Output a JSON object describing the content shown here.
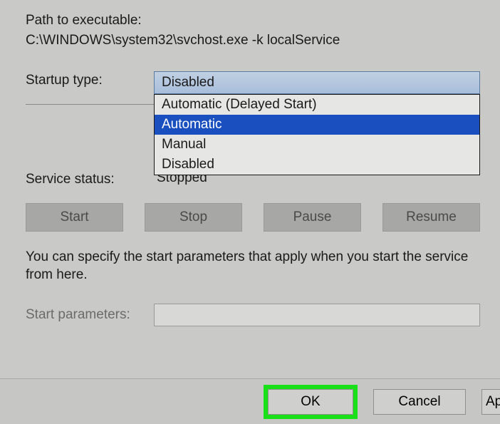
{
  "path": {
    "label": "Path to executable:",
    "value": "C:\\WINDOWS\\system32\\svchost.exe -k localService"
  },
  "startup": {
    "label": "Startup type:",
    "selected": "Disabled",
    "options": {
      "o0": "Automatic (Delayed Start)",
      "o1": "Automatic",
      "o2": "Manual",
      "o3": "Disabled"
    }
  },
  "status": {
    "label": "Service status:",
    "value": "Stopped"
  },
  "buttons": {
    "start": "Start",
    "stop": "Stop",
    "pause": "Pause",
    "resume": "Resume"
  },
  "description": "You can specify the start parameters that apply when you start the service from here.",
  "params": {
    "label": "Start parameters:",
    "value": ""
  },
  "footer": {
    "ok": "OK",
    "cancel": "Cancel",
    "apply": "Apply"
  }
}
